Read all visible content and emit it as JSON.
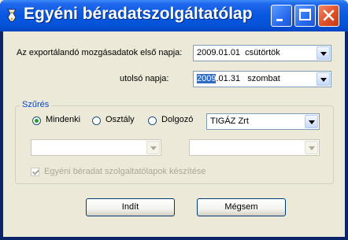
{
  "window": {
    "title": "Egyéni béradatszolgáltatólap"
  },
  "form": {
    "first_day_label": "Az exportálandó mozgásadatok első napja:",
    "first_day_value": "2009.01.01  csütörtök",
    "last_day_label": "utolsó napja:",
    "last_day_selected": "2009",
    "last_day_rest": ".01.31   szombat"
  },
  "filter": {
    "legend": "Szűrés",
    "options": [
      "Mindenki",
      "Osztály",
      "Dolgozó"
    ],
    "selected": "Mindenki",
    "company": "TIGÁZ Zrt",
    "checkbox_label": "Egyéni béradat szolgaltatólapok készítése",
    "checkbox_checked": true
  },
  "buttons": {
    "start": "Indít",
    "cancel": "Mégsem"
  }
}
